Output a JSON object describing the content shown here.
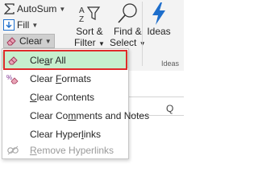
{
  "ribbon": {
    "autosum": {
      "label": "AutoSum",
      "icon": "sigma-icon"
    },
    "fill": {
      "label": "Fill",
      "icon": "fill-down-icon"
    },
    "clear": {
      "label": "Clear",
      "icon": "eraser-icon"
    },
    "sort_filter": {
      "line1": "Sort &",
      "line2": "Filter",
      "icon": "sort-filter-icon"
    },
    "find_select": {
      "line1": "Find &",
      "line2": "Select",
      "icon": "magnifier-icon"
    },
    "ideas": {
      "label": "Ideas",
      "icon": "lightning-icon",
      "group_label": "Ideas"
    }
  },
  "menu": {
    "items": [
      {
        "pre": "Cle",
        "u": "a",
        "post": "r All",
        "icon": "eraser-icon",
        "selected": true,
        "disabled": false
      },
      {
        "pre": "Clear ",
        "u": "F",
        "post": "ormats",
        "icon": "clear-formats-icon",
        "selected": false,
        "disabled": false
      },
      {
        "pre": "",
        "u": "C",
        "post": "lear Contents",
        "icon": "",
        "selected": false,
        "disabled": false
      },
      {
        "pre": "Clear Co",
        "u": "m",
        "post": "ments and Notes",
        "icon": "",
        "selected": false,
        "disabled": false
      },
      {
        "pre": "Clear Hyper",
        "u": "l",
        "post": "inks",
        "icon": "",
        "selected": false,
        "disabled": false
      },
      {
        "pre": "",
        "u": "R",
        "post": "emove Hyperlinks",
        "icon": "remove-hyperlink-icon",
        "selected": false,
        "disabled": true
      }
    ]
  },
  "sheet": {
    "column_label": "Q"
  },
  "colors": {
    "highlight": "#e02b2b",
    "selected_bg": "#c6efce",
    "ideas_blue": "#1e6ecb"
  }
}
